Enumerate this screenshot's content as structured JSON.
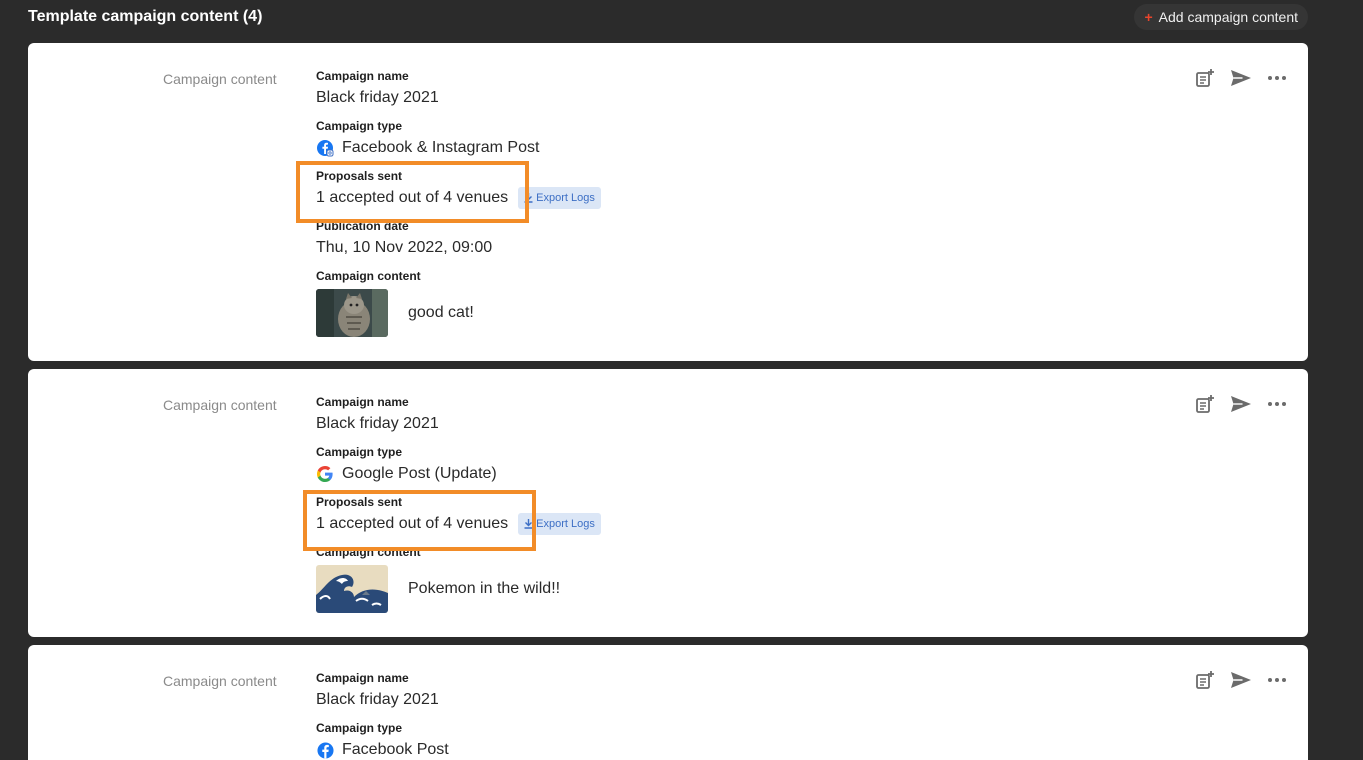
{
  "header": {
    "title": "Template campaign content (4)",
    "add_button": "Add campaign content"
  },
  "labels": {
    "section": "Campaign content",
    "campaign_name": "Campaign name",
    "campaign_type": "Campaign type",
    "proposals_sent": "Proposals sent",
    "publication_date": "Publication date",
    "campaign_content": "Campaign content",
    "export_logs": "Export Logs"
  },
  "cards": [
    {
      "campaign_name": "Black friday 2021",
      "campaign_type": "Facebook & Instagram Post",
      "type_icon": "facebook-instagram-icon",
      "proposals": "1 accepted out of 4 venues",
      "publication_date": "Thu, 10 Nov 2022, 09:00",
      "content_text": "good cat!"
    },
    {
      "campaign_name": "Black friday 2021",
      "campaign_type": "Google Post (Update)",
      "type_icon": "google-icon",
      "proposals": "1 accepted out of 4 venues",
      "content_text": "Pokemon in the wild!!"
    },
    {
      "campaign_name": "Black friday 2021",
      "campaign_type": "Facebook Post",
      "type_icon": "facebook-icon"
    }
  ],
  "colors": {
    "background": "#2b2b2b",
    "highlight": "#f28c28",
    "export_bg": "#dbe6f6",
    "export_text": "#3d6fc5",
    "facebook": "#1877f2"
  }
}
